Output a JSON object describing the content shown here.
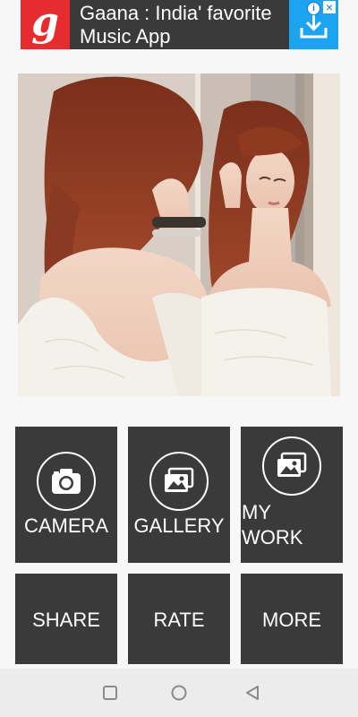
{
  "ad": {
    "title": "Gaana : India' favorite\nMusic App",
    "logo_letter": "g",
    "info_glyph": "i",
    "close_glyph": "×",
    "logo_color": "#e72c30",
    "download_color": "#1da4f0"
  },
  "hero": {
    "image": "woman-mirror-photo"
  },
  "tiles": {
    "camera": {
      "label": "CAMERA",
      "icon": "camera-icon"
    },
    "gallery": {
      "label": "GALLERY",
      "icon": "gallery-icon"
    },
    "my_work": {
      "label": "MY\nWORK",
      "icon": "my-work-icon"
    },
    "share": {
      "label": "SHARE"
    },
    "rate": {
      "label": "RATE"
    },
    "more": {
      "label": "MORE"
    }
  },
  "navbar": {
    "recents": "square-icon",
    "home": "circle-icon",
    "back": "triangle-icon"
  },
  "colors": {
    "tile_bg": "#3a3a3a",
    "page_bg": "#f7f7f7",
    "navbar_bg": "#ececec"
  }
}
